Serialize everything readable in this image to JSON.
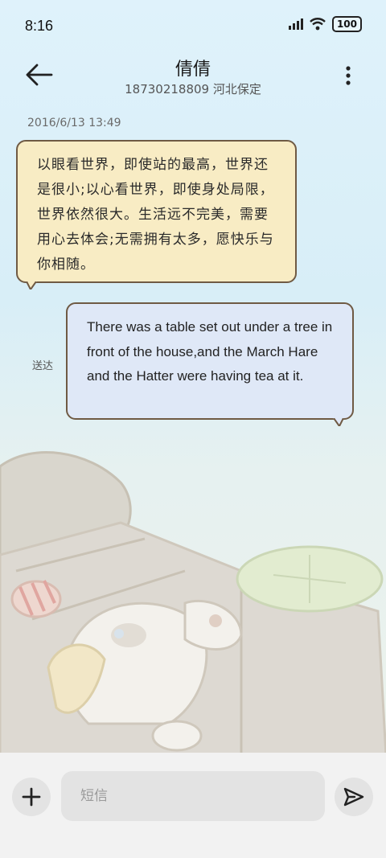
{
  "status_bar": {
    "time": "8:16",
    "battery": "100"
  },
  "header": {
    "contact_name": "倩倩",
    "contact_detail": "18730218809 河北保定"
  },
  "conversation": {
    "timestamp": "2016/6/13 13:49",
    "messages": [
      {
        "direction": "incoming",
        "text": "以眼看世界，即使站的最高，世界还是很小;以心看世界，即使身处局限，世界依然很大。生活远不完美，需要用心去体会;无需拥有太多，愿快乐与你相随。"
      },
      {
        "direction": "outgoing",
        "text": "There was a table set out under a tree in front of the house,and the March Hare and the Hatter were having tea at it.",
        "status": "送达"
      }
    ]
  },
  "composer": {
    "placeholder": "短信",
    "value": ""
  },
  "icons": {
    "back": "arrow-left-icon",
    "menu": "more-vertical-icon",
    "add": "plus-icon",
    "send": "send-icon",
    "signal": "signal-icon",
    "wifi": "wifi-icon",
    "battery": "battery-icon"
  },
  "colors": {
    "incoming_bubble": "#f8ecc4",
    "outgoing_bubble": "#dfe8f7",
    "bubble_border": "#6f5a44"
  }
}
